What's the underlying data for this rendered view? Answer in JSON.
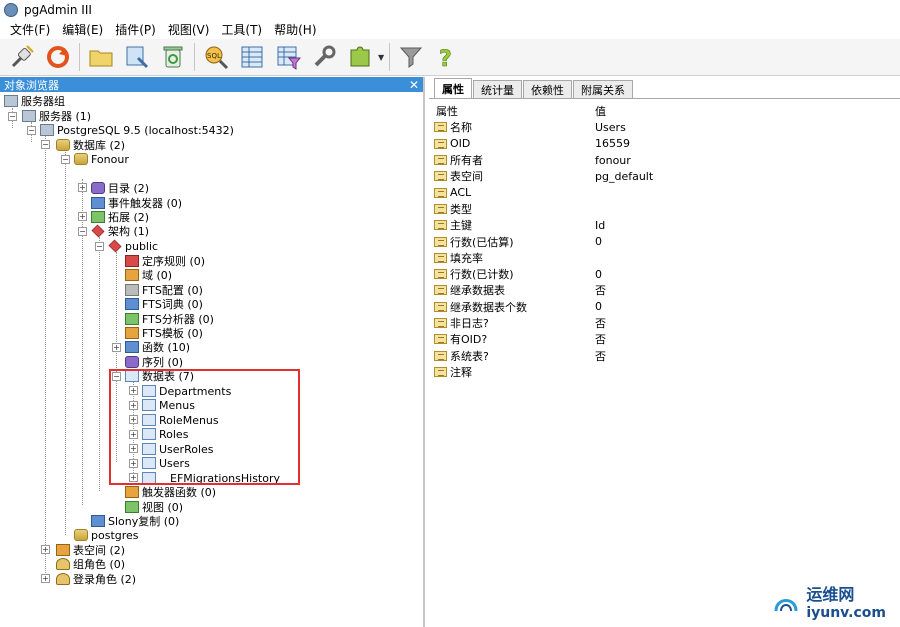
{
  "window": {
    "title": "pgAdmin III"
  },
  "menu": [
    "文件(F)",
    "编辑(E)",
    "插件(P)",
    "视图(V)",
    "工具(T)",
    "帮助(H)"
  ],
  "toolbar": {
    "buttons": [
      "connect-icon",
      "refresh-icon",
      "folder-icon",
      "properties-icon",
      "delete-icon",
      "sql-icon",
      "view-data-icon",
      "filter-data-icon",
      "maintenance-icon",
      "plugin-icon",
      "hint-icon",
      "help-icon"
    ]
  },
  "browser": {
    "title": "对象浏览器",
    "nodes": [
      "服务器组",
      "服务器 (1)",
      "PostgreSQL 9.5 (localhost:5432)",
      "数据库 (2)",
      "Fonour",
      "目录 (2)",
      "事件触发器 (0)",
      "拓展 (2)",
      "架构 (1)",
      "public",
      "定序规则 (0)",
      "域 (0)",
      "FTS配置 (0)",
      "FTS词典 (0)",
      "FTS分析器 (0)",
      "FTS模板 (0)",
      "函数 (10)",
      "序列 (0)",
      "数据表 (7)",
      "Departments",
      "Menus",
      "RoleMenus",
      "Roles",
      "UserRoles",
      "Users",
      "__EFMigrationsHistory",
      "触发器函数 (0)",
      "视图 (0)",
      "Slony复制 (0)",
      "postgres",
      "表空间 (2)",
      "组角色 (0)",
      "登录角色 (2)"
    ]
  },
  "properties": {
    "tabs": [
      "属性",
      "统计量",
      "依赖性",
      "附属关系"
    ],
    "header": {
      "name": "属性",
      "value": "值"
    },
    "rows": [
      {
        "name": "名称",
        "value": "Users"
      },
      {
        "name": "OID",
        "value": "16559"
      },
      {
        "name": "所有者",
        "value": "fonour"
      },
      {
        "name": "表空间",
        "value": "pg_default"
      },
      {
        "name": "ACL",
        "value": ""
      },
      {
        "name": "类型",
        "value": ""
      },
      {
        "name": "主键",
        "value": "Id"
      },
      {
        "name": "行数(已估算)",
        "value": "0"
      },
      {
        "name": "填充率",
        "value": ""
      },
      {
        "name": "行数(已计数)",
        "value": "0"
      },
      {
        "name": "继承数据表",
        "value": "否"
      },
      {
        "name": "继承数据表个数",
        "value": "0"
      },
      {
        "name": "非日志?",
        "value": "否"
      },
      {
        "name": "有OID?",
        "value": "否"
      },
      {
        "name": "系统表?",
        "value": "否"
      },
      {
        "name": "注释",
        "value": ""
      }
    ]
  },
  "watermark": {
    "cn": "运维网",
    "en": "iyunv.com"
  },
  "colors": {
    "panel_header": "#3b8fd9",
    "highlight": "#e23030"
  }
}
